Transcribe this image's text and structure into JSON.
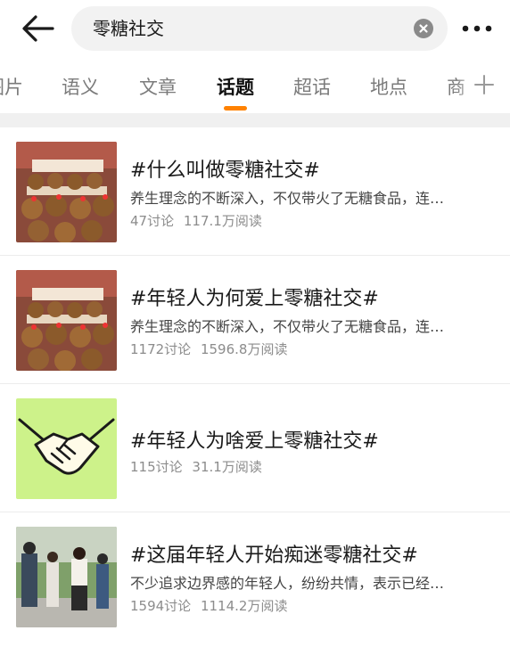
{
  "search": {
    "query": "零糖社交"
  },
  "icons": {
    "back": "arrow-left-icon",
    "clear": "close-circle-icon",
    "more": "more-horizontal-icon",
    "add": "plus-icon"
  },
  "colors": {
    "accent": "#ff8200",
    "title_text": "#1a1a1a",
    "secondary_text": "#8c8c8c",
    "tab_inactive": "#7b7b7b"
  },
  "tabs": [
    {
      "label": "图片",
      "active": false
    },
    {
      "label": "语义",
      "active": false
    },
    {
      "label": "文章",
      "active": false
    },
    {
      "label": "话题",
      "active": true
    },
    {
      "label": "超话",
      "active": false
    },
    {
      "label": "地点",
      "active": false
    },
    {
      "label": "商",
      "active": false
    }
  ],
  "topics": [
    {
      "title": "#什么叫做零糖社交#",
      "desc": "养生理念的不断深入，不仅带火了无糖食品，连…",
      "discussions": "47讨论",
      "reads": "117.1万阅读",
      "thumb": "plush-toys"
    },
    {
      "title": "#年轻人为何爱上零糖社交#",
      "desc": "养生理念的不断深入，不仅带火了无糖食品，连…",
      "discussions": "1172讨论",
      "reads": "1596.8万阅读",
      "thumb": "plush-toys"
    },
    {
      "title": "#年轻人为啥爱上零糖社交#",
      "desc": "",
      "discussions": "115讨论",
      "reads": "31.1万阅读",
      "thumb": "handshake"
    },
    {
      "title": "#这届年轻人开始痴迷零糖社交#",
      "desc": "不少追求边界感的年轻人，纷纷共情，表示已经…",
      "discussions": "1594讨论",
      "reads": "1114.2万阅读",
      "thumb": "people-photo"
    }
  ]
}
